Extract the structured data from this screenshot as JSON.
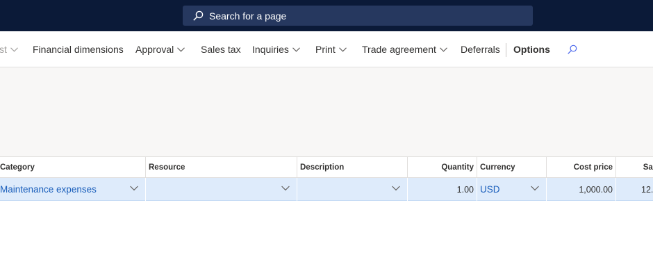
{
  "topbar": {
    "search_placeholder": "Search for a page"
  },
  "actionpane": {
    "items": [
      {
        "label": "st",
        "has_dropdown": true
      },
      {
        "label": "Financial dimensions",
        "has_dropdown": false
      },
      {
        "label": "Approval",
        "has_dropdown": true
      },
      {
        "label": "Sales tax",
        "has_dropdown": false
      },
      {
        "label": "Inquiries",
        "has_dropdown": true
      },
      {
        "label": "Print",
        "has_dropdown": true
      },
      {
        "label": "Trade agreement",
        "has_dropdown": true
      },
      {
        "label": "Deferrals",
        "has_dropdown": false
      },
      {
        "label": "Options",
        "has_dropdown": false
      }
    ],
    "search_icon": "search-icon"
  },
  "grid": {
    "columns": [
      "Category",
      "Resource",
      "Description",
      "Quantity",
      "Currency",
      "Cost price",
      "Sal"
    ],
    "rows": [
      {
        "category": "Maintenance expenses",
        "resource": "",
        "description": "",
        "quantity": "1.00",
        "currency": "USD",
        "cost_price": "1,000.00",
        "sales": "12."
      }
    ]
  },
  "colors": {
    "topbar": "#0b1a38",
    "search_bg": "#26385f",
    "row_selected": "#deebfb",
    "link": "#1b5fbb"
  }
}
